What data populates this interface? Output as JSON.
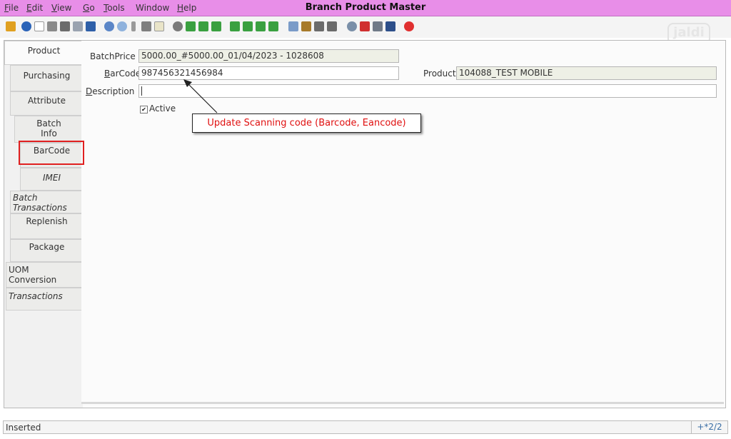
{
  "app": {
    "title": "Branch Product Master",
    "logo": "jaldi"
  },
  "menu": [
    {
      "key": "F",
      "rest": "ile"
    },
    {
      "key": "E",
      "rest": "dit"
    },
    {
      "key": "V",
      "rest": "iew"
    },
    {
      "key": "G",
      "rest": "o"
    },
    {
      "key": "T",
      "rest": "ools"
    },
    {
      "key": "",
      "rest": "Window"
    },
    {
      "key": "H",
      "rest": "elp"
    }
  ],
  "toolbar_icons": [
    "undo-icon",
    "help-icon",
    "new-icon",
    "copy-icon",
    "delete-icon",
    "delete-selection-icon",
    "save-icon",
    "refresh-icon",
    "find-icon",
    "attachment-icon",
    "chat-icon",
    "history-icon",
    "home-icon",
    "archive-icon",
    "previous-icon",
    "next-icon",
    "first-record-icon",
    "parent-icon",
    "detail-icon",
    "last-record-icon",
    "report-icon",
    "archived-report-icon",
    "print-preview-icon",
    "print-icon",
    "zoom-across-icon",
    "workflow-icon",
    "product-info-icon",
    "request-icon",
    "exit-icon"
  ],
  "tabs": [
    {
      "label": "Product"
    },
    {
      "label": "Purchasing"
    },
    {
      "label": "Attribute"
    },
    {
      "label": "Batch\nInfo"
    },
    {
      "label": "BarCode"
    },
    {
      "label": "IMEI"
    },
    {
      "label": "Batch\nTransactions"
    },
    {
      "label": "Replenish"
    },
    {
      "label": "Package"
    },
    {
      "label": "UOM\nConversion"
    },
    {
      "label": "Transactions"
    }
  ],
  "form": {
    "batch_price": {
      "label": "BatchPrice",
      "value": "5000.00_#5000.00_01/04/2023 - 1028608"
    },
    "barcode": {
      "label_key": "B",
      "label_rest": "arCode",
      "value": "987456321456984"
    },
    "product": {
      "label": "Product",
      "value": "104088_TEST MOBILE"
    },
    "description": {
      "label_key": "D",
      "label_rest": "escription",
      "value": ""
    },
    "active": {
      "label": "Active",
      "checked": true
    }
  },
  "annotation": "Update Scanning code (Barcode, Eancode)",
  "status": {
    "text": "Inserted",
    "record": "+*2/2"
  }
}
